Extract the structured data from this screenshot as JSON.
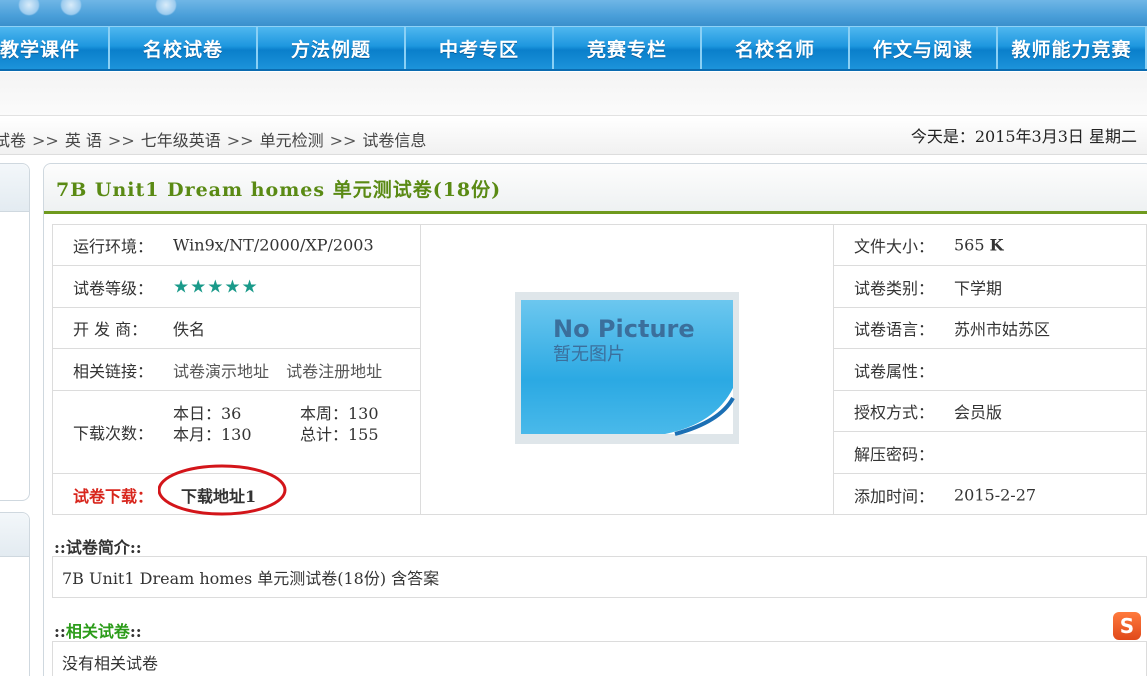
{
  "nav": {
    "items": [
      {
        "label": "教学课件",
        "width": 110
      },
      {
        "label": "名校试卷",
        "width": 148
      },
      {
        "label": "方法例题",
        "width": 148
      },
      {
        "label": "中考专区",
        "width": 148
      },
      {
        "label": "竞赛专栏",
        "width": 148
      },
      {
        "label": "名校名师",
        "width": 148
      },
      {
        "label": "作文与阅读",
        "width": 148
      },
      {
        "label": "教师能力竞赛",
        "width": 149
      }
    ]
  },
  "breadcrumb": {
    "items": [
      "试卷",
      "英 语",
      "七年级英语",
      "单元检测",
      "试卷信息"
    ],
    "separator": ">>"
  },
  "today": "今天是：2015年3月3日 星期二",
  "paper": {
    "title": "7B Unit1 Dream homes 单元测试卷(18份)",
    "env_label": "运行环境：",
    "env_value": "Win9x/NT/2000/XP/2003",
    "level_label": "试卷等级：",
    "level_stars": "★★★★★",
    "level_value": 5,
    "dev_label": "开 发 商：",
    "dev_value": "佚名",
    "links_label": "相关链接：",
    "link_demo": "试卷演示地址",
    "link_register": "试卷注册地址",
    "downloads_label": "下载次数：",
    "downloads": {
      "day": "本日：36",
      "week": "本周：130",
      "month": "本月：130",
      "total": "总计：155"
    },
    "download_label": "试卷下载：",
    "download_link": "下载地址1",
    "size_label": "文件大小：",
    "size_value": "565",
    "size_unit": "K",
    "category_label": "试卷类别：",
    "category_value": "下学期",
    "lang_label": "试卷语言：",
    "lang_value": "苏州市姑苏区",
    "attr_label": "试卷属性：",
    "attr_value": "",
    "license_label": "授权方式：",
    "license_value": "会员版",
    "password_label": "解压密码：",
    "password_value": "",
    "added_label": "添加时间：",
    "added_value": "2015-2-27",
    "nopic_en": "No Picture",
    "nopic_cn": "暂无图片"
  },
  "intro": {
    "prefix": "::",
    "title": "试卷简介",
    "suffix": "::",
    "text": "7B Unit1 Dream homes 单元测试卷(18份) 含答案"
  },
  "related": {
    "prefix": "::",
    "title": "相关试卷",
    "suffix": "::",
    "text": "没有相关试卷"
  },
  "colors": {
    "nav_blue": "#1e97df",
    "title_green": "#5a8a14",
    "download_red": "#d8261d",
    "annotation_red": "#d3151a",
    "star_teal": "#1a9a8a"
  }
}
